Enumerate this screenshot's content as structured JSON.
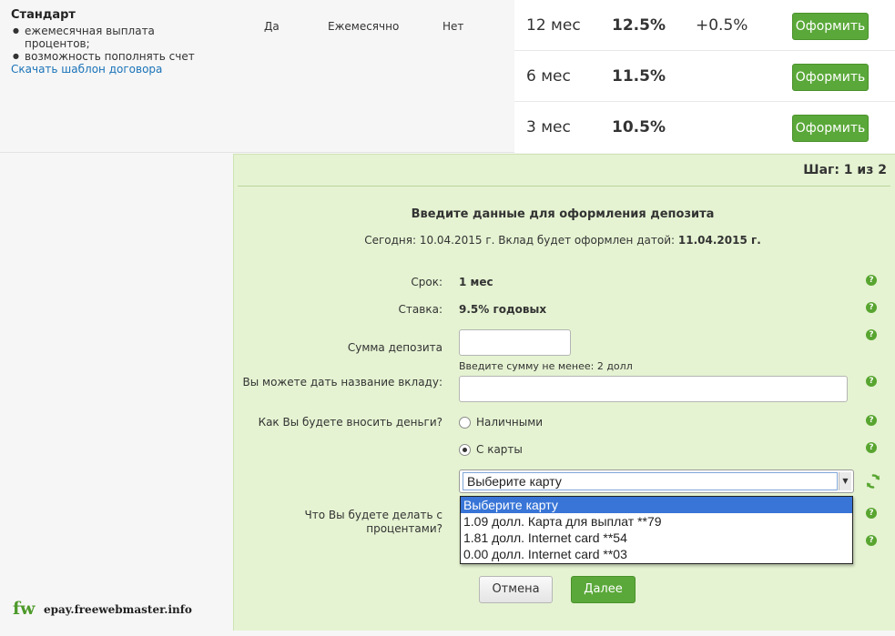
{
  "product": {
    "title": "Стандарт",
    "features": [
      "ежемесячная выплата процентов;",
      "возможность пополнять счет"
    ],
    "download_link": "Скачать шаблон договора",
    "replenish": "Да",
    "payout": "Ежемесячно",
    "early_withdrawal": "Нет"
  },
  "rates": [
    {
      "term": "12 мес",
      "rate": "12.5%",
      "bonus": "+0.5%",
      "button": "Оформить"
    },
    {
      "term": "6 мес",
      "rate": "11.5%",
      "bonus": "",
      "button": "Оформить"
    },
    {
      "term": "3 мес",
      "rate": "10.5%",
      "bonus": "",
      "button": "Оформить"
    }
  ],
  "form": {
    "step": "Шаг: 1 из 2",
    "title": "Введите данные для оформления депозита",
    "today_label": "Сегодня: 10.04.2015 г.  Вклад будет оформлен датой:",
    "issue_date": "11.04.2015 г.",
    "term_label": "Срок:",
    "term_value": "1 мес",
    "rate_label": "Ставка:",
    "rate_value": "9.5% годовых",
    "amount_label": "Сумма депозита",
    "amount_value": "",
    "amount_hint": "Введите сумму не менее: 2 долл",
    "name_label": "Вы можете дать название вкладу:",
    "name_value": "",
    "funding_label": "Как Вы будете вносить деньги?",
    "funding_options": [
      "Наличными",
      "С карты"
    ],
    "funding_selected": "С карты",
    "card_select_value": "Выберите карту",
    "card_options": [
      "Выберите карту",
      "1.09 долл. Карта для выплат **79",
      "1.81 долл. Internet card **54",
      "0.00 долл. Internet card **03"
    ],
    "interest_label": "Что Вы будете делать с процентами?",
    "cancel_button": "Отмена",
    "next_button": "Далее",
    "help_icon": "?"
  },
  "logo": {
    "mark": "fw",
    "text": "epay.freewebmaster.info"
  },
  "colors": {
    "accent_green": "#5aa839",
    "panel_bg": "#e5f3d2",
    "link_blue": "#1a73b8",
    "highlight_blue": "#3875d7"
  }
}
